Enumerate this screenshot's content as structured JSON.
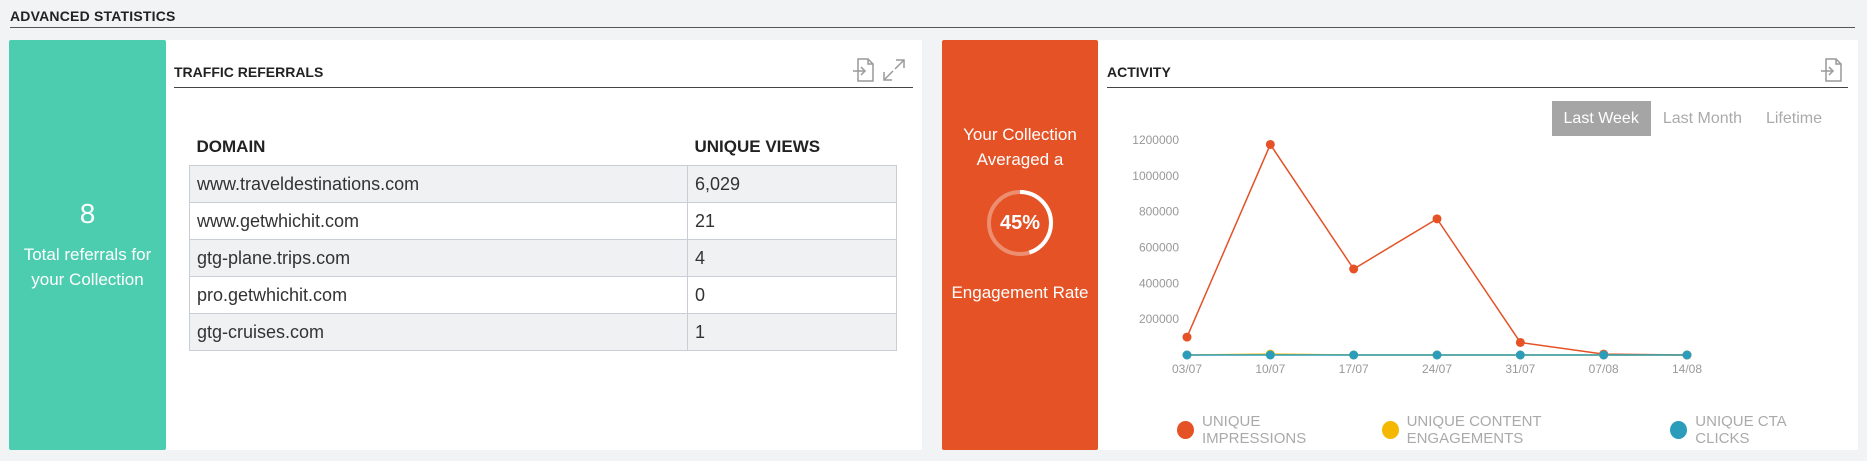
{
  "page": {
    "title": "ADVANCED STATISTICS"
  },
  "referrals": {
    "summary_value": "8",
    "summary_label": "Total referrals for your Collection",
    "card_title": "TRAFFIC REFERRALS",
    "columns": [
      "DOMAIN",
      "UNIQUE VIEWS"
    ],
    "rows": [
      [
        "www.traveldestinations.com",
        "6,029"
      ],
      [
        "www.getwhichit.com",
        "21"
      ],
      [
        "gtg-plane.trips.com",
        "4"
      ],
      [
        "pro.getwhichit.com",
        "0"
      ],
      [
        "gtg-cruises.com",
        "1"
      ]
    ],
    "tile_color": "#4ccdb0"
  },
  "engagement": {
    "top_text": "Your Collection Averaged a",
    "rate": "45%",
    "rate_value": 0.45,
    "bottom_text": "Engagement Rate",
    "tile_color": "#e45226"
  },
  "activity": {
    "card_title": "ACTIVITY",
    "tabs": [
      "Last Week",
      "Last Month",
      "Lifetime"
    ],
    "active_tab": 0
  },
  "icons": {
    "export": "export-icon",
    "expand": "expand-icon"
  },
  "chart_data": {
    "type": "line",
    "x": [
      "03/07",
      "10/07",
      "17/07",
      "24/07",
      "31/07",
      "07/08",
      "14/08"
    ],
    "ylim": [
      0,
      1200000
    ],
    "yticks": [
      200000,
      400000,
      600000,
      800000,
      1000000,
      1200000
    ],
    "grid": false,
    "legend_position": "bottom",
    "series": [
      {
        "name": "UNIQUE IMPRESSIONS",
        "color": "#e45226",
        "values": [
          100000,
          1175000,
          480000,
          760000,
          70000,
          5000,
          0
        ]
      },
      {
        "name": "UNIQUE CONTENT ENGAGEMENTS",
        "color": "#f5b800",
        "values": [
          0,
          5000,
          0,
          0,
          0,
          0,
          0
        ]
      },
      {
        "name": "UNIQUE CTA CLICKS",
        "color": "#2b9dbb",
        "values": [
          0,
          0,
          0,
          0,
          0,
          0,
          0
        ]
      }
    ]
  }
}
